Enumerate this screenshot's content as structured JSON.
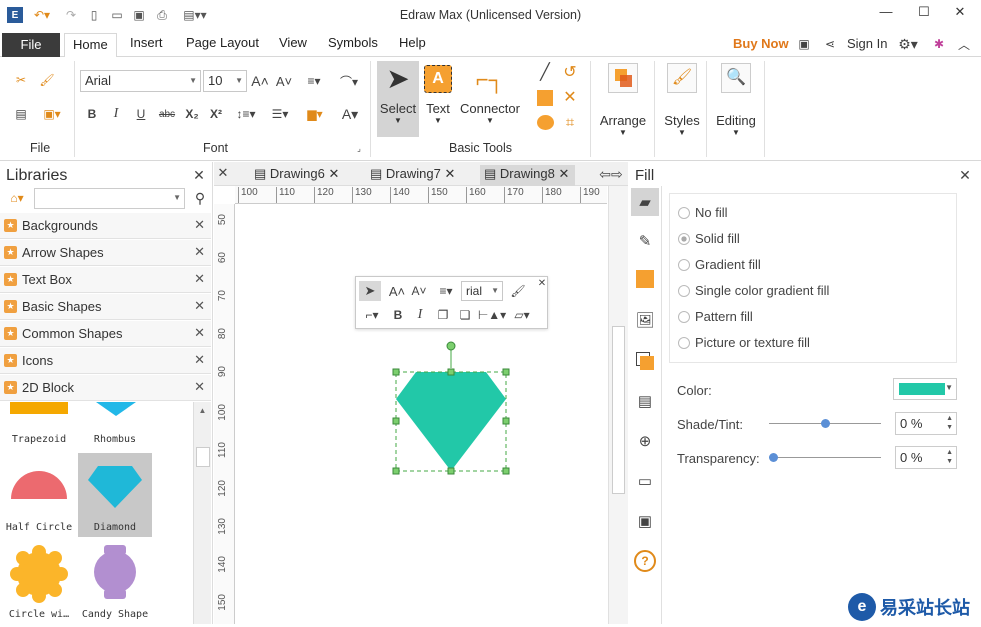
{
  "app_title": "Edraw Max (Unlicensed Version)",
  "window_controls": {
    "minimize": "—",
    "maximize": "☐",
    "close": "✕"
  },
  "menu": {
    "file": "File",
    "tabs": [
      "Home",
      "Insert",
      "Page Layout",
      "View",
      "Symbols",
      "Help"
    ],
    "buy_now": "Buy Now",
    "sign_in": "Sign In"
  },
  "ribbon": {
    "font_name": "Arial",
    "font_size": "10",
    "group_file": "File",
    "group_font": "Font",
    "group_basic_tools": "Basic Tools",
    "select": "Select",
    "text": "Text",
    "connector": "Connector",
    "arrange": "Arrange",
    "styles": "Styles",
    "editing": "Editing"
  },
  "libraries": {
    "title": "Libraries",
    "items": [
      "Backgrounds",
      "Arrow Shapes",
      "Text Box",
      "Basic Shapes",
      "Common Shapes",
      "Icons",
      "2D Block"
    ],
    "shapes": [
      "Trapezoid",
      "Rhombus",
      "Half Circle",
      "Diamond",
      "Circle wi…",
      "Candy Shape"
    ]
  },
  "documents": {
    "tabs": [
      "Drawing6",
      "Drawing7",
      "Drawing8"
    ],
    "active": "Drawing8"
  },
  "ruler": {
    "top": [
      "100",
      "110",
      "120",
      "130",
      "140",
      "150",
      "160",
      "170",
      "180",
      "190"
    ],
    "left": [
      "50",
      "60",
      "70",
      "80",
      "90",
      "100",
      "110",
      "120",
      "130",
      "140",
      "150"
    ]
  },
  "floating_toolbar": {
    "font": "rial"
  },
  "fill_panel": {
    "title": "Fill",
    "options": [
      "No fill",
      "Solid fill",
      "Gradient fill",
      "Single color gradient fill",
      "Pattern fill",
      "Picture or texture fill"
    ],
    "selected": "Solid fill",
    "color_label": "Color:",
    "color_value": "#22c8a8",
    "shade_label": "Shade/Tint:",
    "shade_value": "0 %",
    "transparency_label": "Transparency:",
    "transparency_value": "0 %"
  },
  "watermark": {
    "text": "易采站长站"
  },
  "colors": {
    "accent": "#e0781a",
    "shape": "#22c8a8",
    "orange": "#f5a030"
  }
}
